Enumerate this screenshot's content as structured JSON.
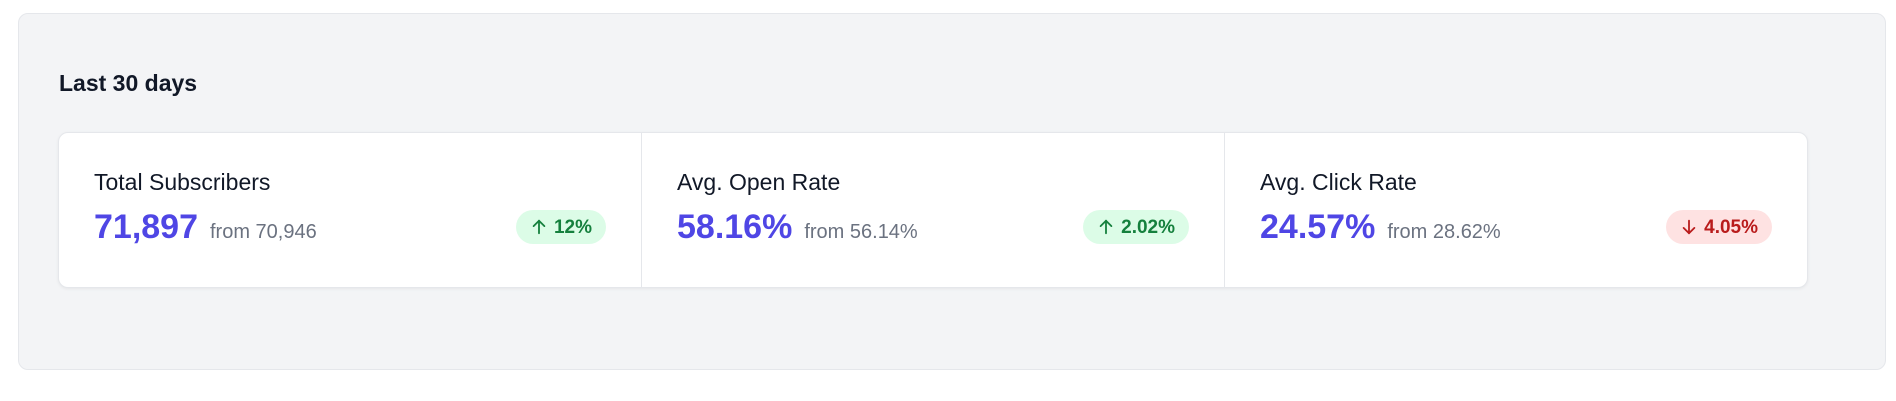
{
  "section": {
    "title": "Last 30 days"
  },
  "stats": [
    {
      "label": "Total Subscribers",
      "value": "71,897",
      "from": "from 70,946",
      "change": "12%",
      "direction": "up"
    },
    {
      "label": "Avg. Open Rate",
      "value": "58.16%",
      "from": "from 56.14%",
      "change": "2.02%",
      "direction": "up"
    },
    {
      "label": "Avg. Click Rate",
      "value": "24.57%",
      "from": "from 28.62%",
      "change": "4.05%",
      "direction": "down"
    }
  ],
  "colors": {
    "value": "#4f46e5",
    "increase_bg": "#dcfce7",
    "increase_text": "#15803d",
    "decrease_bg": "#fee2e2",
    "decrease_text": "#b91c1c"
  },
  "icons": {
    "increase": "arrow-up-icon",
    "decrease": "arrow-down-icon"
  }
}
